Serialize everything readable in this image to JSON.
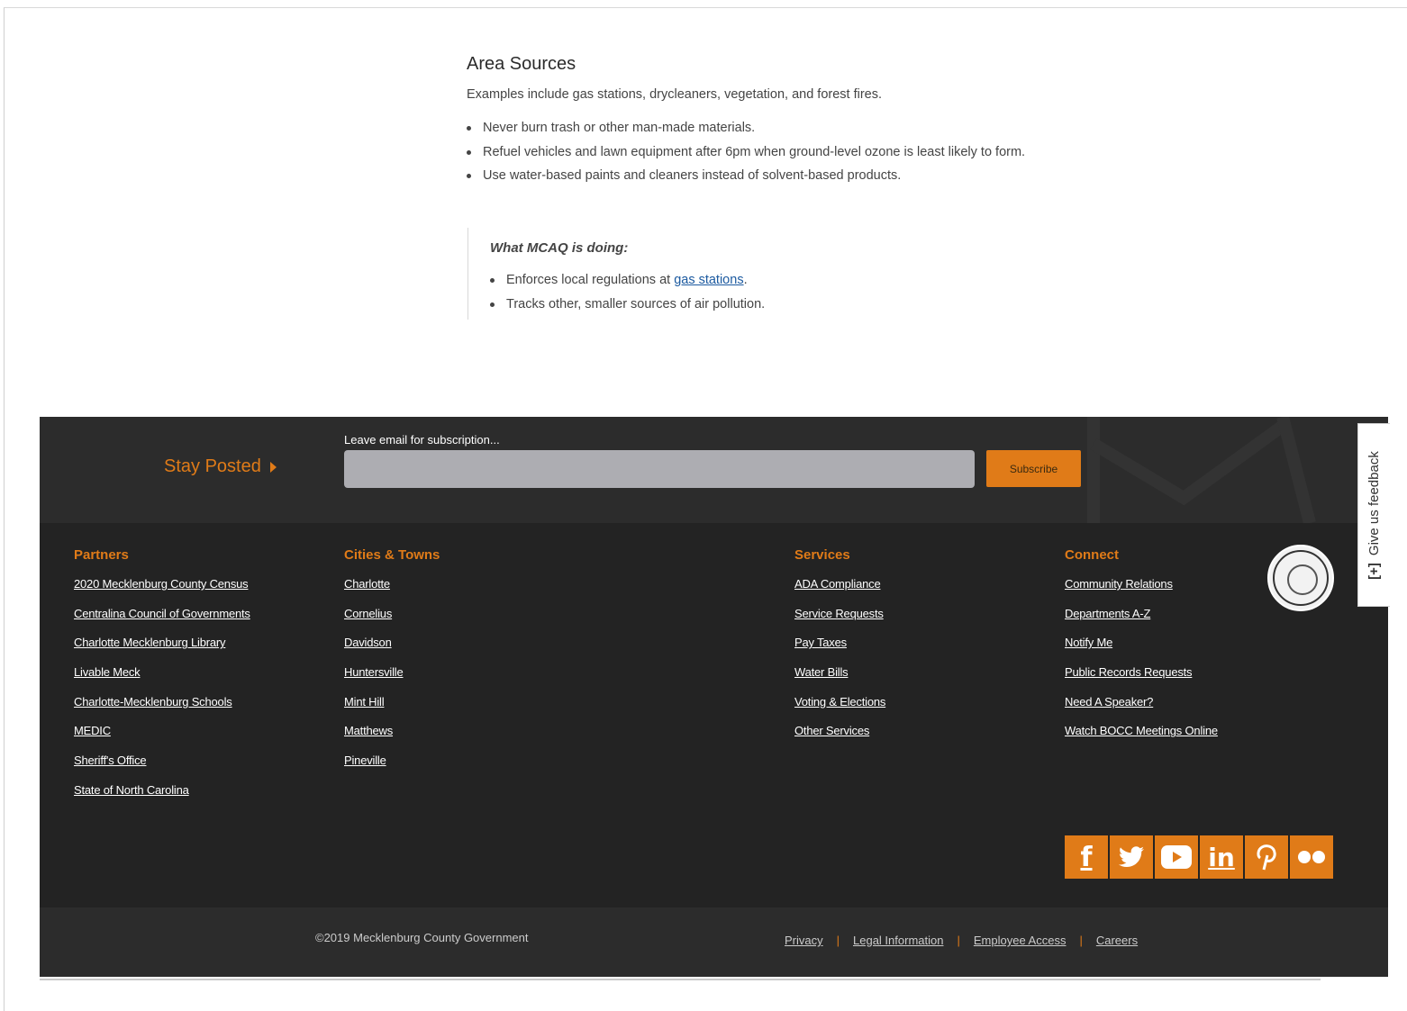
{
  "section": {
    "title": "Area Sources",
    "intro": "Examples include gas stations, drycleaners, vegetation, and forest fires.",
    "bullets": [
      "Never burn trash or other man-made materials.",
      "Refuel vehicles and lawn equipment after 6pm when ground-level ozone is least likely to form.",
      "Use water-based paints and cleaners instead of solvent-based products."
    ]
  },
  "callout": {
    "title": "What MCAQ is doing:",
    "item1_prefix": "Enforces local regulations at ",
    "item1_link": "gas stations",
    "item1_suffix": ".",
    "item2": "Tracks other, smaller sources of air pollution."
  },
  "subscribe": {
    "stay_posted": "Stay Posted",
    "email_label": "Leave email for subscription...",
    "email_value": "",
    "button": "Subscribe"
  },
  "columns": {
    "partners": {
      "title": "Partners",
      "links": [
        "2020 Mecklenburg County Census",
        "Centralina Council of Governments",
        "Charlotte Mecklenburg Library",
        "Livable Meck",
        "Charlotte-Mecklenburg Schools",
        "MEDIC",
        "Sheriff's Office",
        "State of North Carolina"
      ]
    },
    "cities": {
      "title": "Cities & Towns",
      "links": [
        "Charlotte",
        "Cornelius",
        "Davidson",
        "Huntersville",
        "Mint Hill",
        "Matthews",
        "Pineville"
      ]
    },
    "services": {
      "title": "Services",
      "links": [
        "ADA Compliance",
        "Service Requests",
        "Pay Taxes",
        "Water Bills",
        "Voting & Elections",
        "Other Services"
      ]
    },
    "connect": {
      "title": "Connect",
      "links": [
        "Community Relations",
        "Departments A-Z",
        "Notify Me",
        "Public Records Requests",
        "Need A Speaker?",
        "Watch BOCC Meetings Online"
      ]
    }
  },
  "social": [
    {
      "icon": "facebook-icon",
      "glyph": "f"
    },
    {
      "icon": "twitter-icon",
      "glyph": "🐦"
    },
    {
      "icon": "youtube-icon",
      "glyph": "▶"
    },
    {
      "icon": "linkedin-icon",
      "glyph": "in"
    },
    {
      "icon": "pinterest-icon",
      "glyph": "P"
    },
    {
      "icon": "flickr-icon",
      "glyph": "●●"
    }
  ],
  "bottom": {
    "copyright": "©2019 Mecklenburg County Government",
    "links": [
      "Privacy",
      "Legal Information",
      "Employee Access",
      "Careers"
    ],
    "separator": "|"
  },
  "feedback": {
    "label": "Give us feedback",
    "plus": "[+]"
  },
  "colors": {
    "accent": "#e07b18",
    "footer_bg": "#232323",
    "link_blue": "#1c5aa0"
  }
}
